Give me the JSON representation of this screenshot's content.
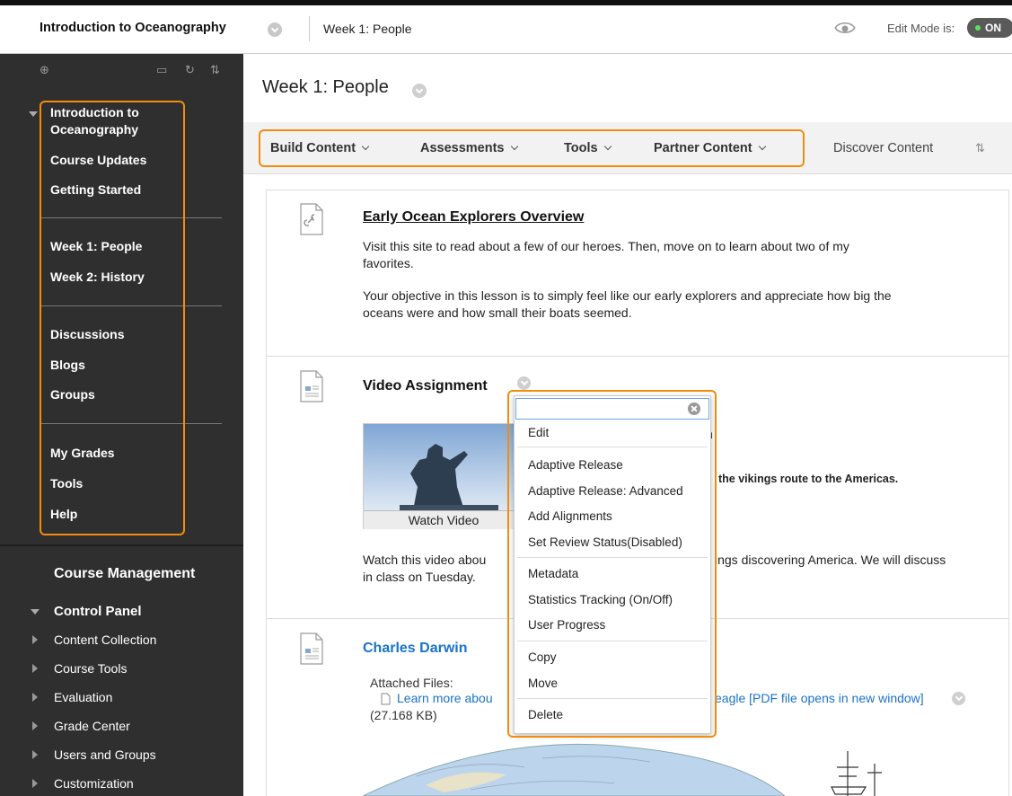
{
  "header": {
    "course_title": "Introduction to Oceanography",
    "breadcrumb": "Week 1: People",
    "edit_mode_label": "Edit Mode is:",
    "edit_mode_state": "ON"
  },
  "sidebar": {
    "course_menu": [
      "Introduction to",
      "Oceanography",
      "Course Updates",
      "Getting Started",
      "Week 1: People",
      "Week 2: History",
      "Discussions",
      "Blogs",
      "Groups",
      "My Grades",
      "Tools",
      "Help"
    ],
    "course_management_title": "Course Management",
    "control_panel_title": "Control Panel",
    "control_panel_items": [
      "Content Collection",
      "Course Tools",
      "Evaluation",
      "Grade Center",
      "Users and Groups",
      "Customization"
    ]
  },
  "main": {
    "page_title": "Week 1: People",
    "actions": [
      "Build Content",
      "Assessments",
      "Tools",
      "Partner Content"
    ],
    "discover": "Discover Content",
    "items": [
      {
        "title": "Early Ocean Explorers Overview",
        "para1_line1": "Visit this site to read about a few of our heroes. Then, move on to learn about two of my",
        "para1_line2": "favorites.",
        "para2_line1": "Your objective in this lesson is to simply feel like our early explorers and appreciate how big the",
        "para2_line2": "oceans were and how small their boats seemed."
      },
      {
        "title": "Video Assignment",
        "watch_label": "Watch Video",
        "right_fragment_top": "n",
        "right_fragment_bold": "the vikings route to the Americas.",
        "desc_left": "Watch this video abou",
        "desc_right": "ings discovering America. We will discuss",
        "desc_line2": "in class on Tuesday."
      },
      {
        "title": "Charles Darwin",
        "attached_label": "Attached Files:",
        "file_link_left": "Learn more abou",
        "file_link_right": "eagle [PDF file opens in new window]",
        "file_size": "(27.168 KB)"
      }
    ]
  },
  "context_menu": {
    "items": [
      "Edit",
      "Adaptive Release",
      "Adaptive Release: Advanced",
      "Add Alignments",
      "Set Review Status(Disabled)",
      "Metadata",
      "Statistics Tracking (On/Off)",
      "User Progress",
      "Copy",
      "Move",
      "Delete"
    ]
  },
  "colors": {
    "highlight": "#f28c0f",
    "sidebar_bg": "#2f2f2f",
    "link_blue": "#1a73c8",
    "toggle_on": "#5ee05e"
  }
}
